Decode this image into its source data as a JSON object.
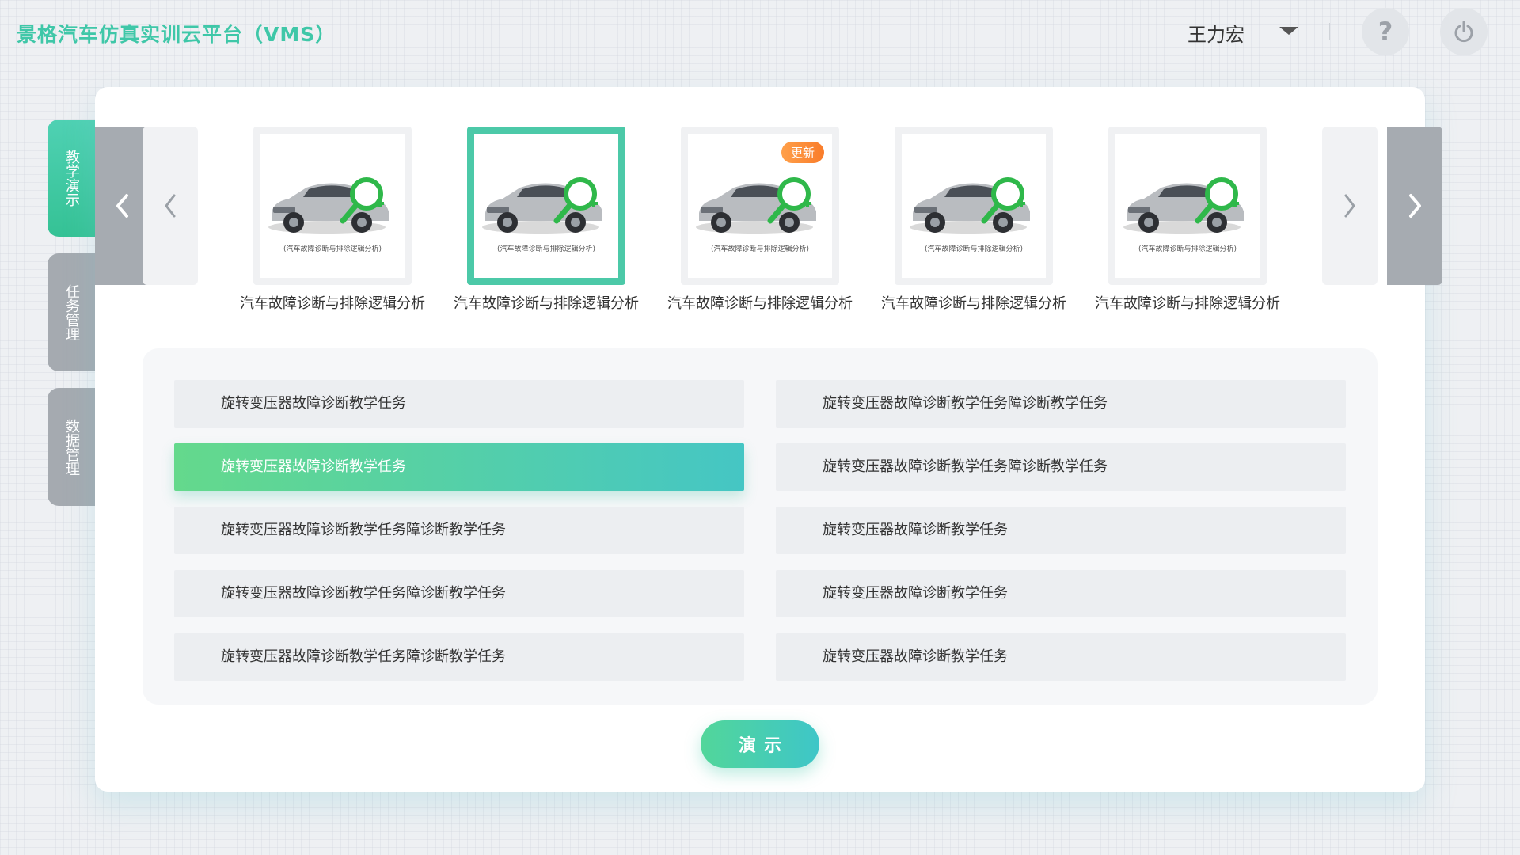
{
  "header": {
    "app_title": "景格汽车仿真实训云平台（VMS）",
    "user_name": "王力宏",
    "help_icon": "?"
  },
  "sidebar": {
    "tabs": [
      {
        "label": "教学演示",
        "active": true
      },
      {
        "label": "任务管理",
        "active": false
      },
      {
        "label": "数据管理",
        "active": false
      }
    ]
  },
  "carousel": {
    "cards": [
      {
        "title": "汽车故障诊断与排除逻辑分析",
        "caption": "(汽车故障诊断与排除逻辑分析)",
        "badge": "",
        "selected": false
      },
      {
        "title": "汽车故障诊断与排除逻辑分析",
        "caption": "(汽车故障诊断与排除逻辑分析)",
        "badge": "",
        "selected": true
      },
      {
        "title": "汽车故障诊断与排除逻辑分析",
        "caption": "(汽车故障诊断与排除逻辑分析)",
        "badge": "更新",
        "selected": false
      },
      {
        "title": "汽车故障诊断与排除逻辑分析",
        "caption": "(汽车故障诊断与排除逻辑分析)",
        "badge": "",
        "selected": false
      },
      {
        "title": "汽车故障诊断与排除逻辑分析",
        "caption": "(汽车故障诊断与排除逻辑分析)",
        "badge": "",
        "selected": false
      }
    ]
  },
  "tasks": {
    "left": [
      {
        "label": "旋转变压器故障诊断教学任务",
        "selected": false
      },
      {
        "label": "旋转变压器故障诊断教学任务",
        "selected": true
      },
      {
        "label": "旋转变压器故障诊断教学任务障诊断教学任务",
        "selected": false
      },
      {
        "label": "旋转变压器故障诊断教学任务障诊断教学任务",
        "selected": false
      },
      {
        "label": "旋转变压器故障诊断教学任务障诊断教学任务",
        "selected": false
      }
    ],
    "right": [
      {
        "label": "旋转变压器故障诊断教学任务障诊断教学任务",
        "selected": false
      },
      {
        "label": "旋转变压器故障诊断教学任务障诊断教学任务",
        "selected": false
      },
      {
        "label": "旋转变压器故障诊断教学任务",
        "selected": false
      },
      {
        "label": "旋转变压器故障诊断教学任务",
        "selected": false
      },
      {
        "label": "旋转变压器故障诊断教学任务",
        "selected": false
      }
    ]
  },
  "actions": {
    "demo_label": "演示"
  },
  "colors": {
    "accent": "#3fc7a8",
    "badge": "#f98a35"
  }
}
